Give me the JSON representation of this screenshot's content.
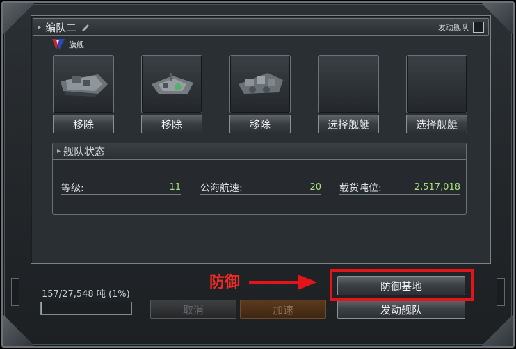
{
  "fleet": {
    "title": "编队二",
    "launch_label": "发动舰队",
    "flagship_label": "旗舰"
  },
  "slots": [
    {
      "button": "移除",
      "icon": "ship-icon"
    },
    {
      "button": "移除",
      "icon": "ship-icon"
    },
    {
      "button": "移除",
      "icon": "ship-icon"
    },
    {
      "button": "选择舰艇",
      "icon": "empty-slot"
    },
    {
      "button": "选择舰艇",
      "icon": "empty-slot"
    }
  ],
  "status": {
    "title": "舰队状态",
    "level_label": "等级:",
    "level_value": "11",
    "speed_label": "公海航速:",
    "speed_value": "20",
    "cargo_label": "载货吨位:",
    "cargo_value": "2,517,018"
  },
  "capacity": {
    "text": "157/27,548 吨 (1%)",
    "fraction": 0.01
  },
  "buttons": {
    "cancel": "取消",
    "accelerate": "加速",
    "defend_base": "防御基地",
    "launch_fleet": "发动舰队"
  },
  "annotation": {
    "text": "防御",
    "color": "#e5141b"
  },
  "colors": {
    "value_green": "#a8e07f",
    "panel_bg": "#2a2f33"
  }
}
